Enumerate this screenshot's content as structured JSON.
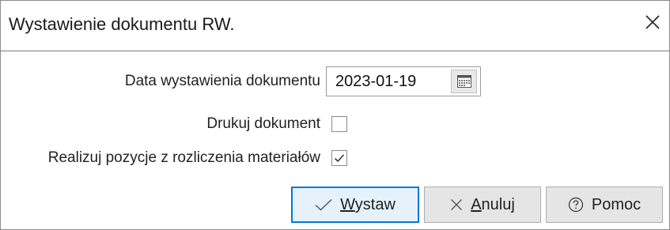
{
  "window": {
    "title": "Wystawienie dokumentu RW.",
    "close_icon": "close-icon"
  },
  "form": {
    "date_label": "Data wystawienia dokumentu",
    "date_value": "2023-01-19",
    "date_picker_icon": "calendar-icon",
    "print_label": "Drukuj dokument",
    "print_checked": false,
    "realize_label": "Realizuj pozycje z rozliczenia materiałów",
    "realize_checked": true
  },
  "buttons": {
    "issue": {
      "mnemonic": "W",
      "rest": "ystaw",
      "icon": "check-icon"
    },
    "cancel": {
      "mnemonic": "A",
      "rest": "nuluj",
      "icon": "close-icon"
    },
    "help": {
      "label": "Pomoc",
      "icon": "help-circle-icon"
    }
  },
  "colors": {
    "focus_border": "#0078d7",
    "button_face": "#e5e5e5",
    "primary_face": "#e5f1fb"
  }
}
